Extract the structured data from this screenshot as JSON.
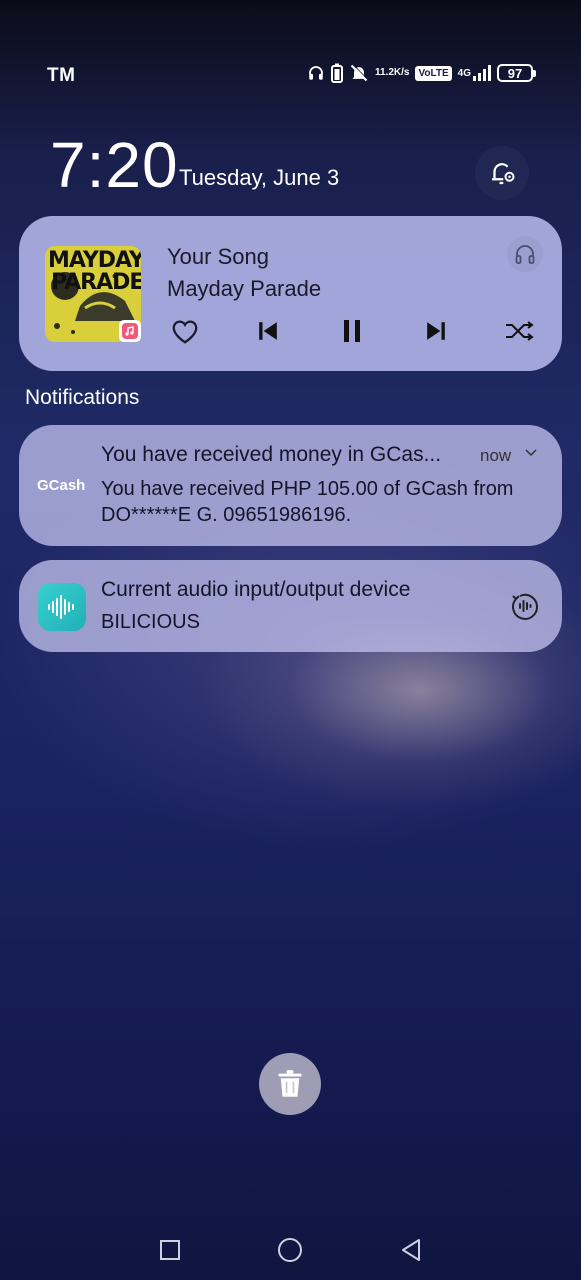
{
  "status_bar": {
    "carrier": "TM",
    "net_speed_value": "11.2",
    "net_speed_unit": "K/s",
    "volte": "VoLTE",
    "network": "4G",
    "battery": "97",
    "icons": [
      "headphones-icon",
      "battery-saver-icon",
      "mute-icon",
      "signal-icon"
    ]
  },
  "lockscreen": {
    "time": "7:20",
    "date": "Tuesday, June 3"
  },
  "media_player": {
    "album_text_line1": "MAYDAY",
    "album_text_line2": "PARADE",
    "title": "Your Song",
    "artist": "Mayday Parade",
    "accent": "#b9bcf0"
  },
  "notifications": {
    "header": "Notifications",
    "items": [
      {
        "app": "GCash",
        "title": "You have received money in GCas...",
        "time": "now",
        "body": "You have received PHP 105.00 of GCash from DO******E G. 09651986196."
      },
      {
        "title": "Current audio input/output device",
        "subtitle": "BILICIOUS",
        "icon": "audio-wave-icon"
      }
    ]
  },
  "actions": {
    "clear_all_icon": "trash-icon"
  },
  "navigation": {
    "buttons": [
      "recents-icon",
      "home-icon",
      "back-icon"
    ]
  }
}
